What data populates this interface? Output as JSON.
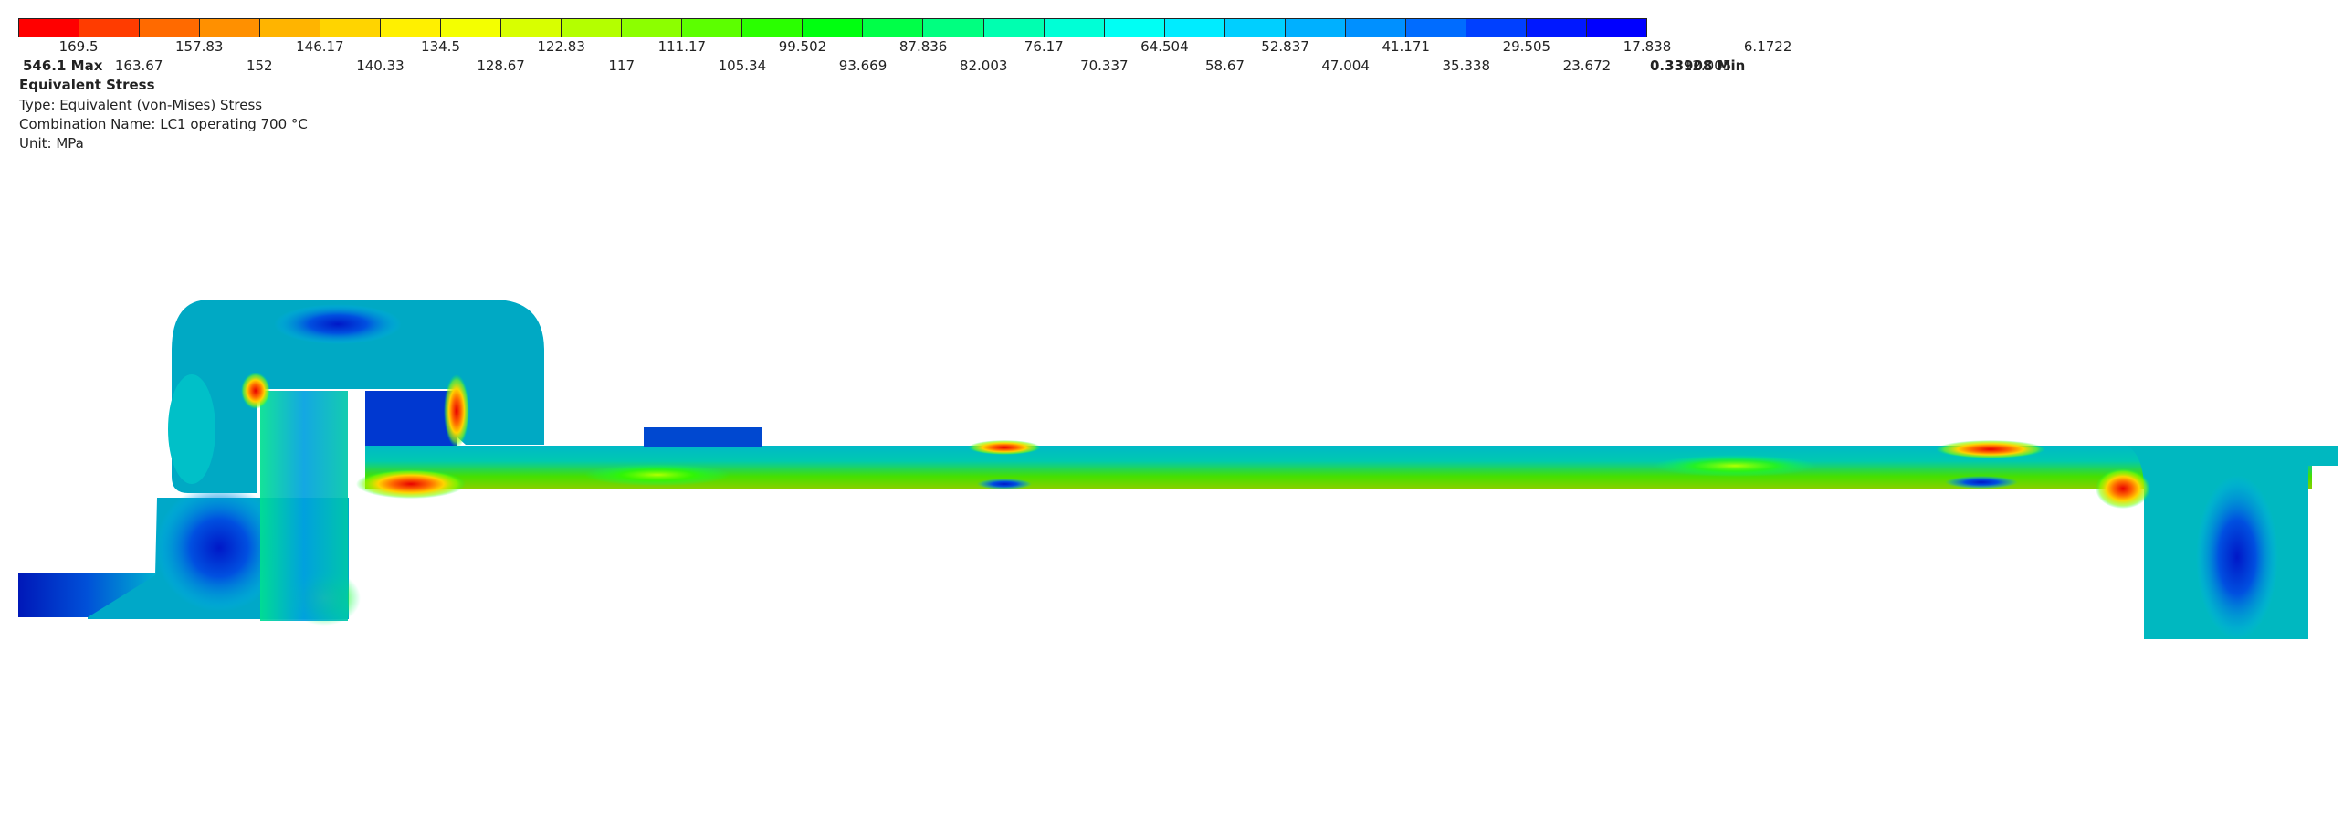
{
  "legend": {
    "colors": [
      "#ff0000",
      "#ff3c00",
      "#ff6a00",
      "#ff9000",
      "#ffb400",
      "#ffd400",
      "#fff000",
      "#f4ff00",
      "#d8ff00",
      "#b4ff00",
      "#8cff00",
      "#5cff00",
      "#2aff00",
      "#00ff10",
      "#00ff48",
      "#00ff80",
      "#00ffb0",
      "#00ffd6",
      "#00fff4",
      "#00ecff",
      "#00cfff",
      "#00b0ff",
      "#0090ff",
      "#006cff",
      "#0040ff",
      "#0018ff",
      "#0000ff"
    ],
    "upper_labels": [
      "169.5",
      "157.83",
      "146.17",
      "134.5",
      "122.83",
      "111.17",
      "99.502",
      "87.836",
      "76.17",
      "64.504",
      "52.837",
      "41.171",
      "29.505",
      "17.838",
      "6.1722"
    ],
    "lower_labels": [
      "163.67",
      "152",
      "140.33",
      "128.67",
      "117",
      "105.34",
      "93.669",
      "82.003",
      "70.337",
      "58.67",
      "47.004",
      "35.338",
      "23.672",
      "12.005"
    ],
    "max_label": "546.1 Max",
    "min_label": "0.33908 Min"
  },
  "info": {
    "title": "Equivalent Stress",
    "type_line": "Type: Equivalent (von-Mises) Stress",
    "combination_line": "Combination Name: LC1 operating 700 °C",
    "unit_line": "Unit: MPa"
  },
  "colors": {
    "text": "#222222",
    "high_stress": "#ff0000",
    "low_stress": "#0000ff",
    "mid_stress": "#00ff48"
  }
}
